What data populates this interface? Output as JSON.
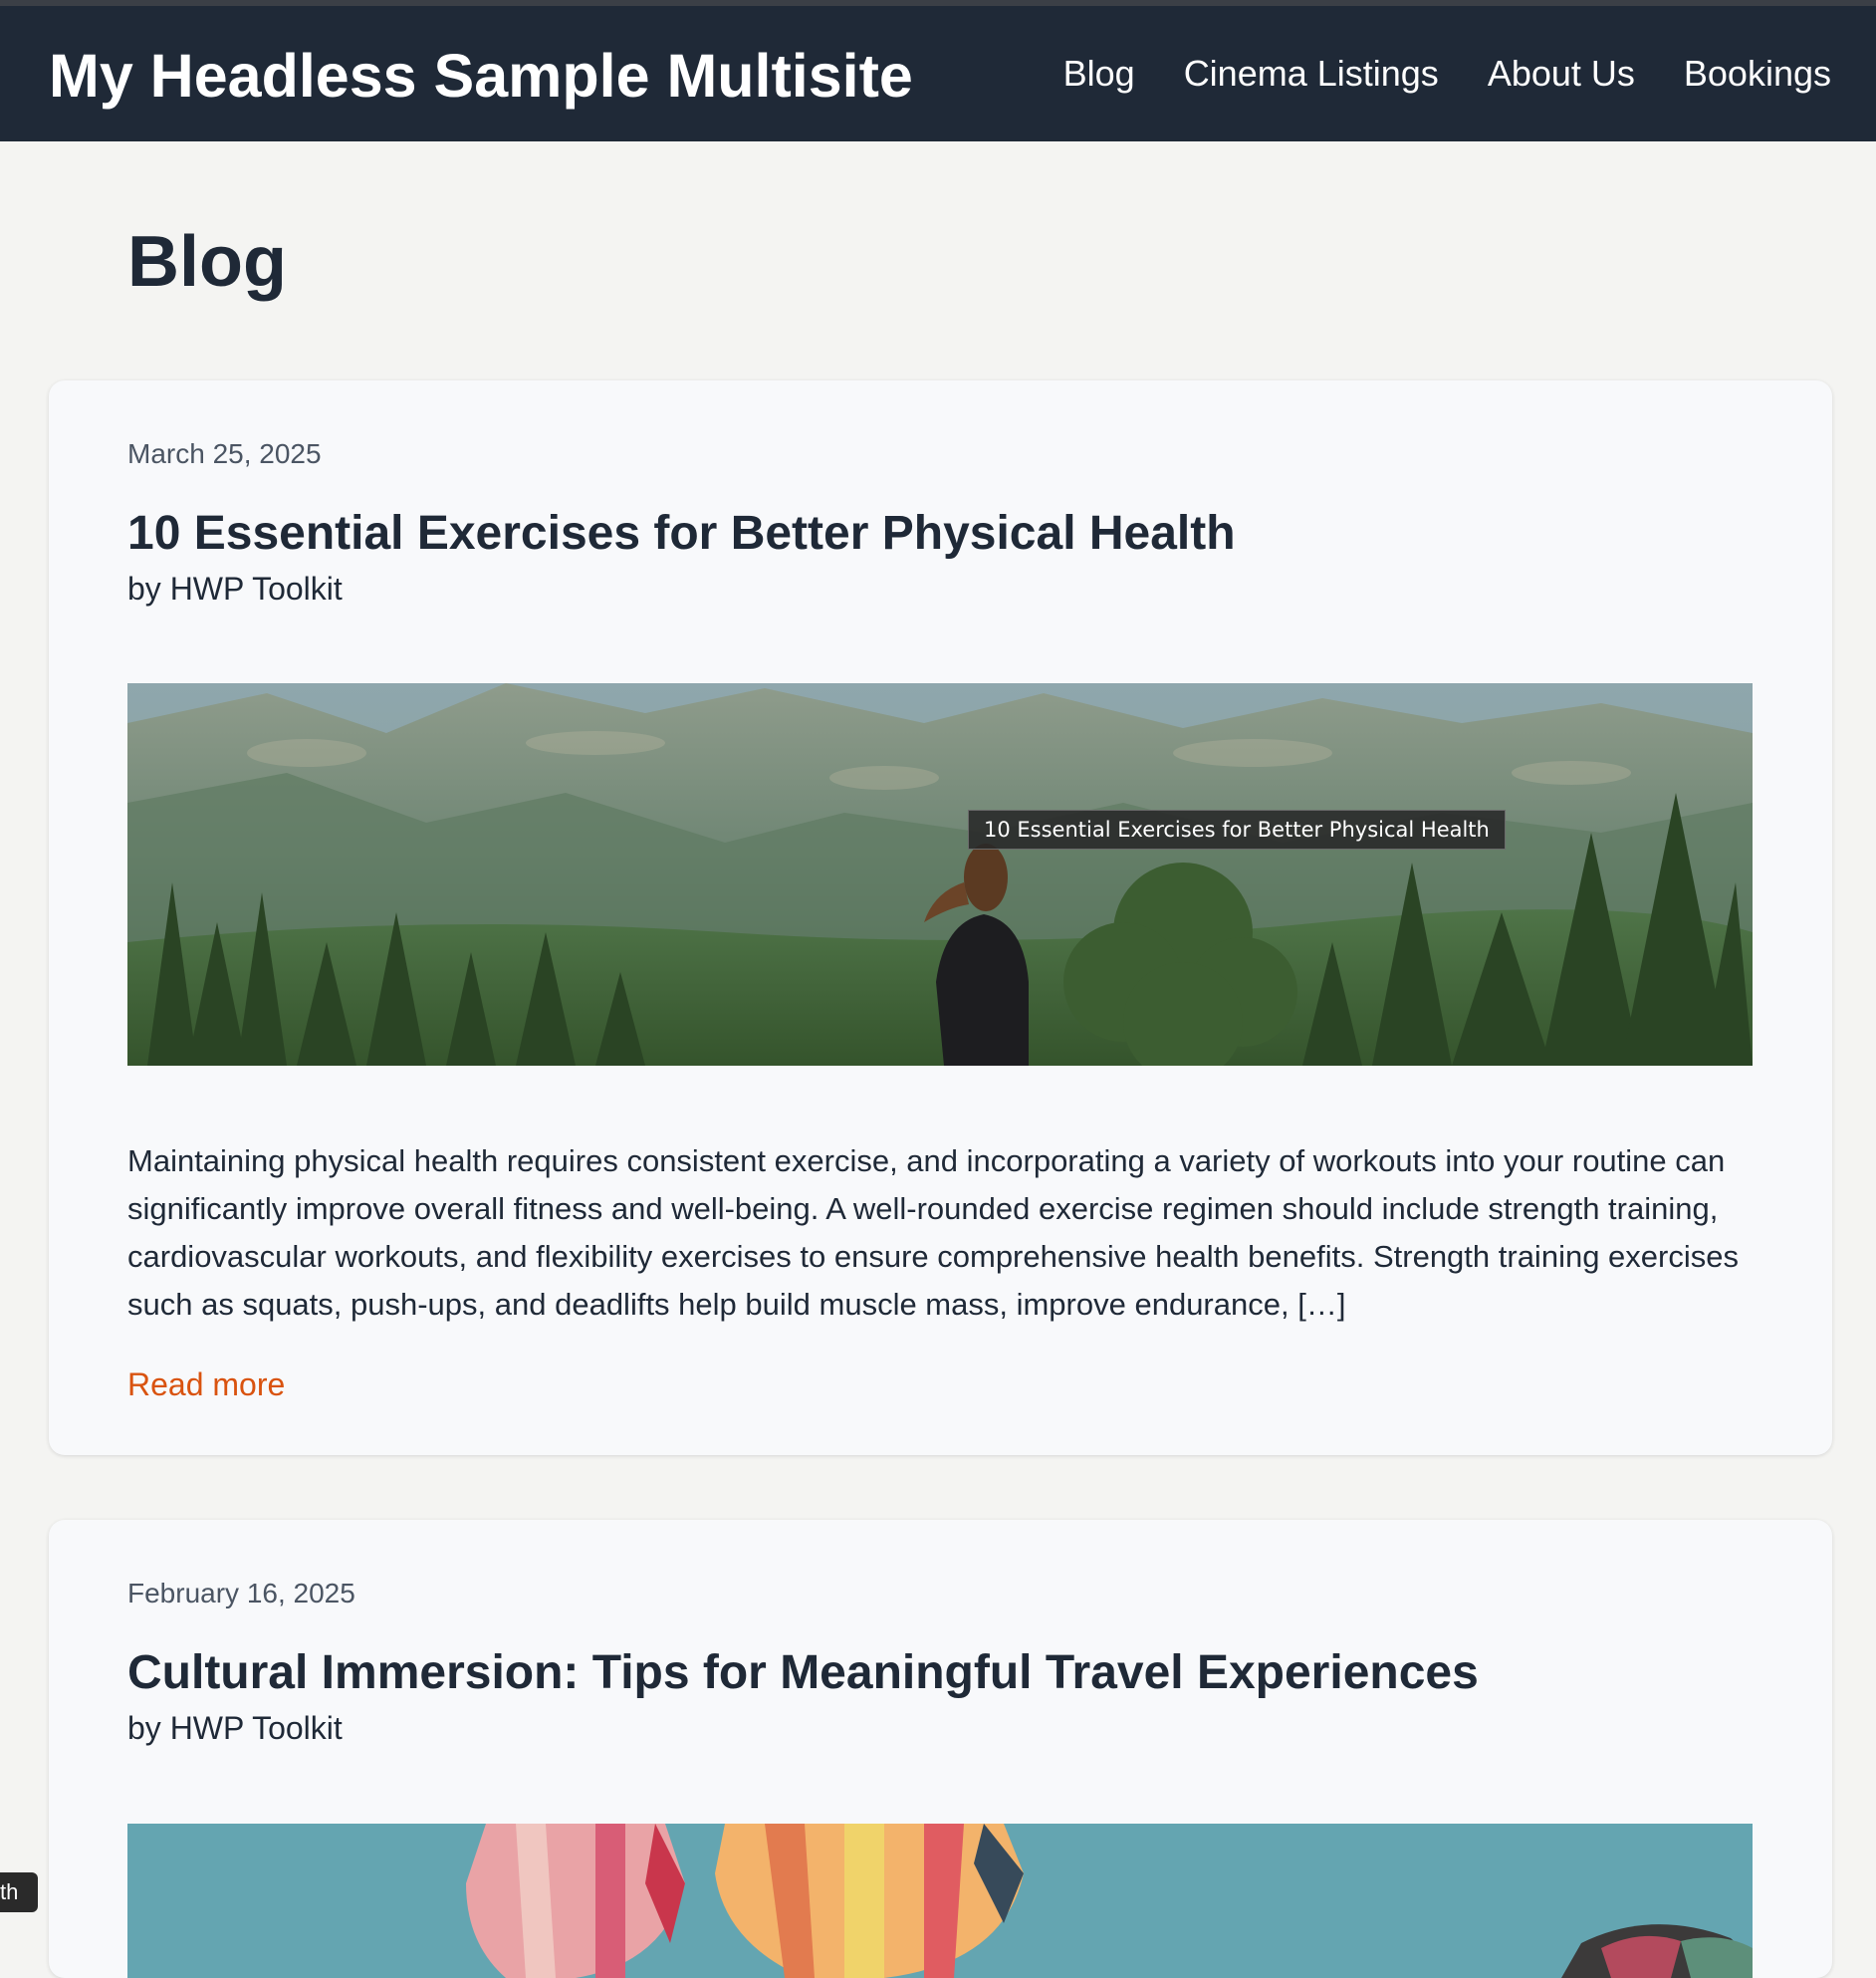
{
  "site": {
    "title": "My Headless Sample Multisite",
    "nav": [
      {
        "label": "Blog"
      },
      {
        "label": "Cinema Listings"
      },
      {
        "label": "About Us"
      },
      {
        "label": "Bookings"
      }
    ]
  },
  "page": {
    "heading": "Blog"
  },
  "posts": [
    {
      "date": "March 25, 2025",
      "title": "10 Essential Exercises for Better Physical Health",
      "author": "by HWP Toolkit",
      "image_alt": "10 Essential Exercises for Better Physical Health",
      "excerpt": "Maintaining physical health requires consistent exercise, and incorporating a variety of workouts into your routine can significantly improve overall fitness and well-being. A well-rounded exercise regimen should include strength training, cardiovascular workouts, and flexibility exercises to ensure comprehensive health benefits. Strength training exercises such as squats, push-ups, and deadlifts help build muscle mass, improve endurance, […]",
      "read_more": "Read more"
    },
    {
      "date": "February 16, 2025",
      "title": "Cultural Immersion: Tips for Meaningful Travel Experiences",
      "author": "by HWP Toolkit"
    }
  ],
  "tooltip": {
    "text": "10 Essential Exercises for Better Physical Health"
  },
  "corner_chip": {
    "text": "th"
  },
  "colors": {
    "header_bg": "#1f2937",
    "page_bg": "#f4f4f2",
    "card_bg": "#f8f9fb",
    "link_accent": "#d9530f"
  },
  "icons": {
    "image1": "mountain-landscape-photo",
    "image2": "hot-air-balloons-photo"
  }
}
